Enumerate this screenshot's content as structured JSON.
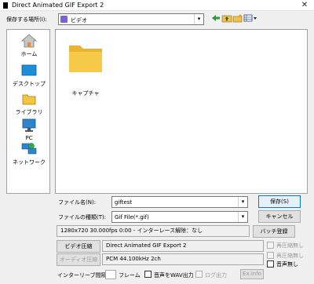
{
  "window": {
    "title": "Direct Animated GIF Export 2",
    "close_glyph": "✕"
  },
  "lookin": {
    "label": "保存する場所(I):",
    "value": "ビデオ",
    "arrow": "▾"
  },
  "places": [
    {
      "label": "ホーム",
      "icon": "home-icon"
    },
    {
      "label": "デスクトップ",
      "icon": "desktop-icon"
    },
    {
      "label": "ライブラリ",
      "icon": "library-icon"
    },
    {
      "label": "PC",
      "icon": "pc-icon"
    },
    {
      "label": "ネットワーク",
      "icon": "network-icon"
    }
  ],
  "files": [
    {
      "name": "キャプチャ",
      "icon": "folder-icon"
    }
  ],
  "filename": {
    "label": "ファイル名(N):",
    "value": "giftest",
    "arrow": "▾"
  },
  "filetype": {
    "label": "ファイルの種類(T):",
    "value": "Gif File(*.gif)",
    "arrow": "▾"
  },
  "buttons": {
    "save": "保存(S)",
    "cancel": "キャンセル",
    "batch": "バッチ登録"
  },
  "info": {
    "text": "1280x720  30.000fps  0:00  -  インターレース解除：なし"
  },
  "video": {
    "button": "ビデオ圧縮",
    "codec": "Direct Animated GIF Export 2"
  },
  "audio": {
    "button": "オーディオ圧縮",
    "codec": "PCM 44.100kHz 2ch"
  },
  "options": {
    "replay_off_1": "再圧縮無し",
    "replay_off_2": "再圧縮無し",
    "audio_none": "音声無し",
    "interleave_label": "インターリーブ間隔：",
    "frame": "フレーム",
    "wav_output": "音声をWAV出力",
    "log_output": "ログ出力",
    "ex_info": "Ex.info"
  },
  "colors": {
    "accent": "#0078d7",
    "folder": "#f7c948"
  }
}
